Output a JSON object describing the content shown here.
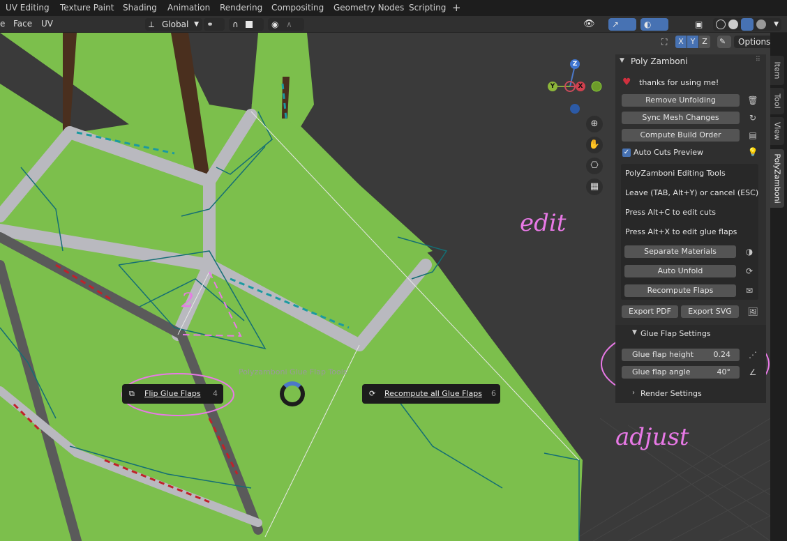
{
  "workspace_tabs": [
    "UV Editing",
    "Texture Paint",
    "Shading",
    "Animation",
    "Rendering",
    "Compositing",
    "Geometry Nodes",
    "Scripting"
  ],
  "add_tab_symbol": "+",
  "header": {
    "menu_e": "e",
    "menu_face": "Face",
    "menu_uv": "UV",
    "transform_orientation": "Global",
    "options_label": "Options",
    "axis_x": "X",
    "axis_y": "Y",
    "axis_z": "Z"
  },
  "gizmo": {
    "x": "X",
    "y": "Y",
    "z": "Z"
  },
  "side_tabs": {
    "item": "Item",
    "tool": "Tool",
    "view": "View",
    "polyzamboni": "PolyZamboni"
  },
  "panel": {
    "title": "Poly Zamboni",
    "thanks": "thanks for using me!",
    "remove_unfolding": "Remove Unfolding",
    "sync_mesh": "Sync Mesh Changes",
    "compute_order": "Compute Build Order",
    "auto_cuts": "Auto Cuts Preview",
    "editing_tools_title": "PolyZamboni Editing Tools",
    "leave_hint": "Leave (TAB, Alt+Y) or cancel (ESC)",
    "edit_cuts_hint": "Press Alt+C to edit cuts",
    "edit_glue_hint": "Press Alt+X to edit glue flaps",
    "separate_materials": "Separate Materials",
    "auto_unfold": "Auto Unfold",
    "recompute_flaps": "Recompute Flaps",
    "export_pdf": "Export PDF",
    "export_svg": "Export SVG",
    "glue_settings_title": "Glue Flap Settings",
    "glue_height_label": "Glue flap height",
    "glue_height_value": "0.24",
    "glue_angle_label": "Glue flap angle",
    "glue_angle_value": "40°",
    "render_settings_title": "Render Settings"
  },
  "pie_menu": {
    "title": "Polyzamboni Glue Flap Tools",
    "flip_label": "Flip Glue Flaps",
    "flip_hotkey": "4",
    "recompute_label": "Recompute all Glue Flaps",
    "recompute_hotkey": "6"
  },
  "annotations": {
    "edit": "edit",
    "adjust": "adjust",
    "two": "2"
  },
  "colors": {
    "face_green": "#7cbf4c",
    "edge_grey": "#b9b9bf",
    "annotation_pink": "#e879e6",
    "accent_blue": "#4772b3"
  }
}
